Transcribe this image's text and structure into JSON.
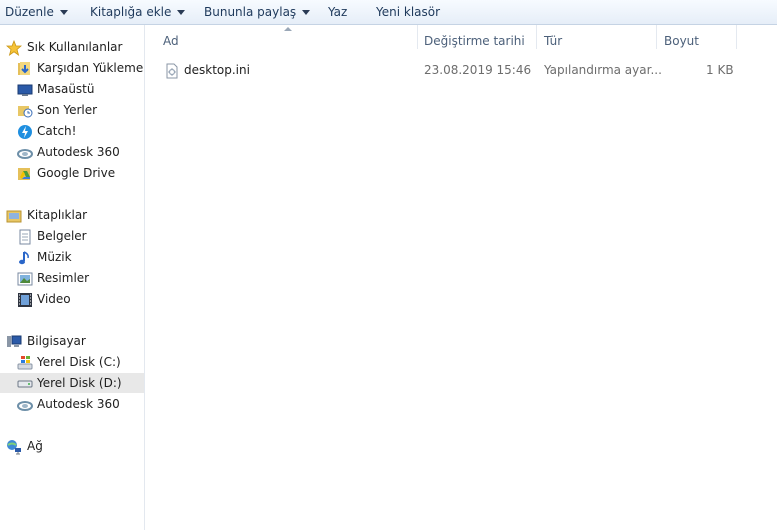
{
  "toolbar": {
    "organize": "Düzenle",
    "add_to_library": "Kitaplığa ekle",
    "share_with": "Bununla paylaş",
    "burn": "Yaz",
    "new_folder": "Yeni klasör"
  },
  "sidebar": {
    "favorites": {
      "title": "Sık Kullanılanlar",
      "items": [
        {
          "label": "Karşıdan Yüklemeler",
          "icon": "downloads-folder-icon"
        },
        {
          "label": "Masaüstü",
          "icon": "desktop-icon"
        },
        {
          "label": "Son Yerler",
          "icon": "recent-places-icon"
        },
        {
          "label": "Catch!",
          "icon": "catch-bolt-icon"
        },
        {
          "label": "Autodesk 360",
          "icon": "autodesk-360-icon"
        },
        {
          "label": "Google Drive",
          "icon": "google-drive-folder-icon"
        }
      ]
    },
    "libraries": {
      "title": "Kitaplıklar",
      "items": [
        {
          "label": "Belgeler",
          "icon": "documents-icon"
        },
        {
          "label": "Müzik",
          "icon": "music-icon"
        },
        {
          "label": "Resimler",
          "icon": "pictures-icon"
        },
        {
          "label": "Video",
          "icon": "video-icon"
        }
      ]
    },
    "computer": {
      "title": "Bilgisayar",
      "items": [
        {
          "label": "Yerel Disk (C:)",
          "icon": "windows-drive-icon"
        },
        {
          "label": "Yerel Disk (D:)",
          "icon": "drive-icon",
          "selected": true
        },
        {
          "label": "Autodesk 360",
          "icon": "autodesk-360-icon"
        }
      ]
    },
    "network": {
      "title": "Ağ",
      "icon": "network-icon"
    }
  },
  "columns": {
    "name": "Ad",
    "date": "Değiştirme tarihi",
    "type": "Tür",
    "size": "Boyut"
  },
  "files": [
    {
      "name": "desktop.ini",
      "date": "23.08.2019 15:46",
      "type": "Yapılandırma ayar...",
      "size": "1 KB",
      "icon": "config-file-icon"
    }
  ]
}
